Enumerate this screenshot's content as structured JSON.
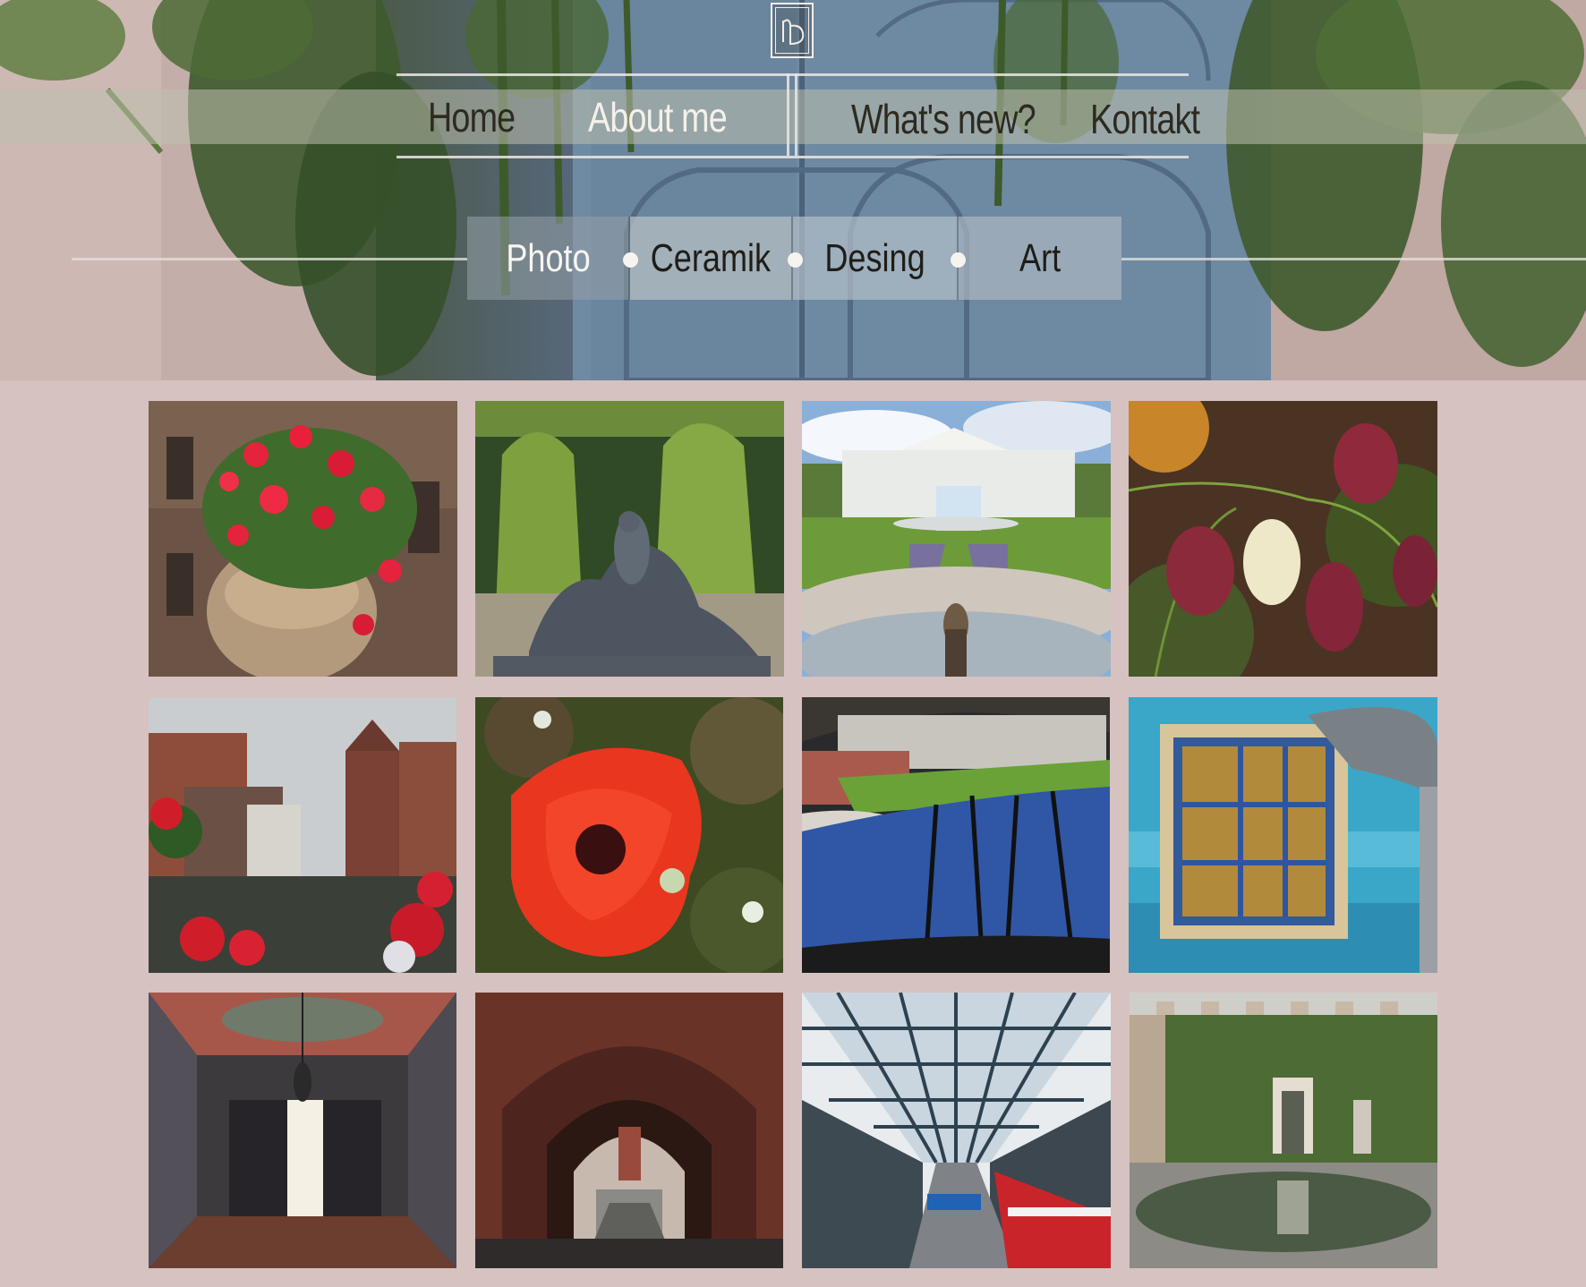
{
  "logo": {
    "icon": "monogram-nd-icon"
  },
  "main_nav": {
    "items": [
      {
        "label": "Home"
      },
      {
        "label": "About me"
      },
      {
        "label": "What's new?"
      },
      {
        "label": "Kontakt"
      }
    ]
  },
  "categories": {
    "items": [
      {
        "label": "Photo"
      },
      {
        "label": "Ceramik"
      },
      {
        "label": "Desing"
      },
      {
        "label": "Art"
      }
    ]
  },
  "gallery": {
    "tiles": [
      {
        "subject": "flower-vase-photo"
      },
      {
        "subject": "fountain-statue-photo"
      },
      {
        "subject": "palace-fountain-photo"
      },
      {
        "subject": "fritillaria-flowers-photo"
      },
      {
        "subject": "river-town-photo"
      },
      {
        "subject": "poppy-photo"
      },
      {
        "subject": "canal-reflection-photo"
      },
      {
        "subject": "blue-window-photo"
      },
      {
        "subject": "ornate-hallway-photo"
      },
      {
        "subject": "brick-archway-photo"
      },
      {
        "subject": "train-station-photo"
      },
      {
        "subject": "courtyard-pond-photo"
      }
    ]
  },
  "colors": {
    "background": "#d6c2c0",
    "nav_text_dark": "#2d2a20",
    "nav_text_light": "#f4f1ea"
  }
}
